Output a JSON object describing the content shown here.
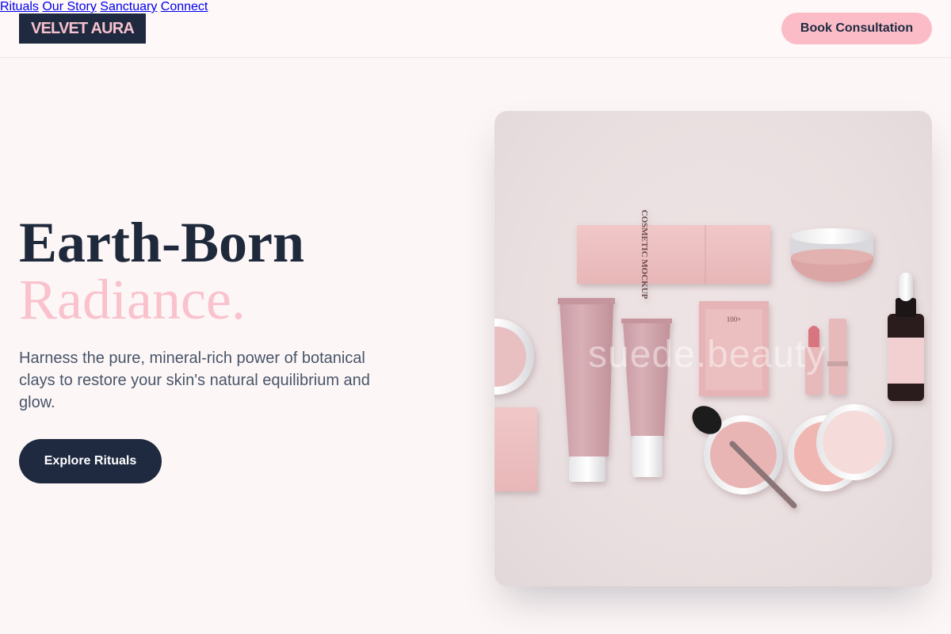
{
  "header": {
    "logo": "VELVET AURA",
    "nav": [
      "Rituals",
      "Our Story",
      "Sanctuary",
      "Connect"
    ],
    "cta": "Book Consultation"
  },
  "hero": {
    "headline_line1": "Earth-Born",
    "headline_line2": "Radiance.",
    "subtext": "Harness the pure, mineral-rich power of botanical clays to restore your skin's natural equilibrium and glow.",
    "button": "Explore Rituals",
    "image_watermark": "suede.beauty",
    "product_labels": {
      "box_top": "COSMETIC MOCKUP",
      "mock": "100+"
    }
  },
  "colors": {
    "navy": "#1f2a40",
    "pink": "#f9c2cc",
    "background": "#fdf6f6"
  }
}
